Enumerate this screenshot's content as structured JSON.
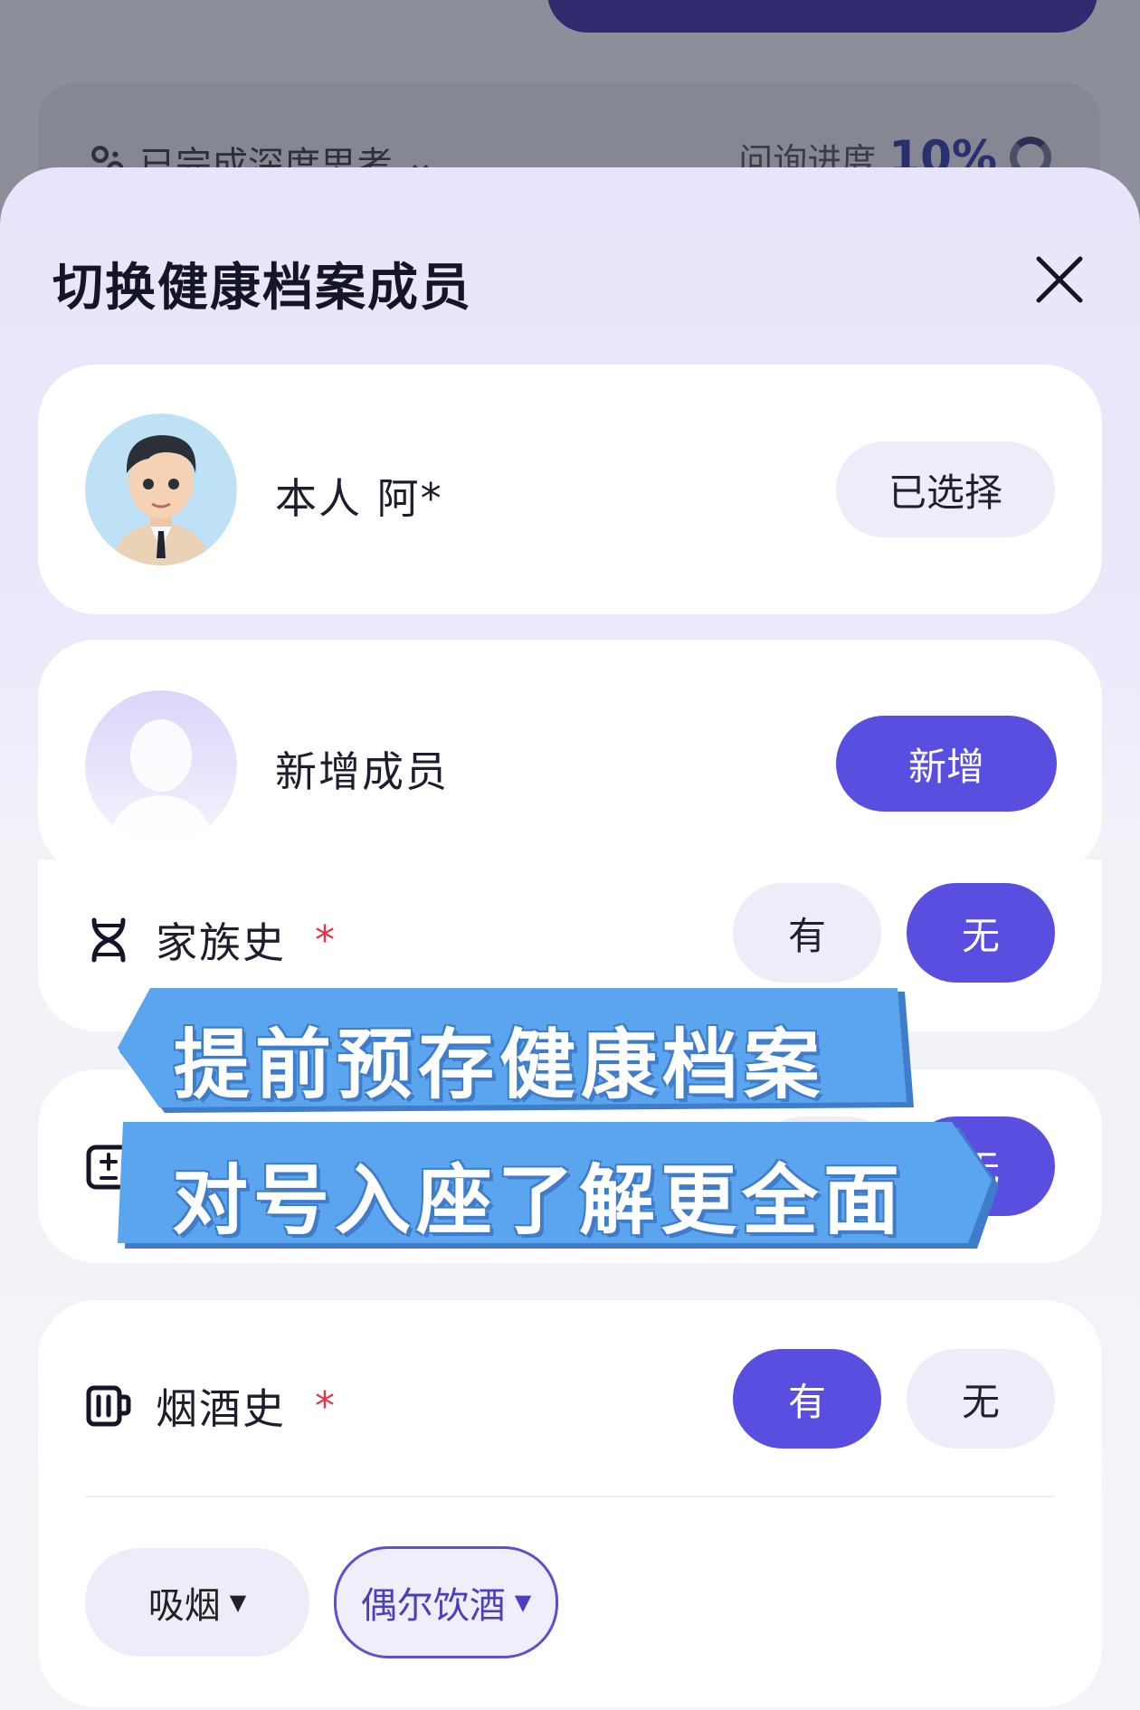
{
  "background": {
    "status_text": "已完成深度思考",
    "progress_label": "问询进度",
    "progress_value": "10%"
  },
  "sheet": {
    "title": "切换健康档案成员"
  },
  "members": [
    {
      "name": "本人 阿*",
      "action": "已选择",
      "selected": true
    },
    {
      "name": "新增成员",
      "action": "新增",
      "selected": false
    }
  ],
  "rows": {
    "family_history": {
      "label": "家族史",
      "required": "*",
      "yes": "有",
      "no": "无",
      "value": "无"
    },
    "row2": {
      "selected": "无"
    },
    "smoke_drink": {
      "label": "烟酒史",
      "required": "*",
      "yes": "有",
      "no": "无",
      "value": "有",
      "chips": [
        {
          "label": "吸烟",
          "active": false
        },
        {
          "label": "偶尔饮酒",
          "active": true
        }
      ]
    }
  },
  "overlay": {
    "line1": "提前预存健康档案",
    "line2": "对号入座了解更全面"
  },
  "colors": {
    "primary": "#5a4ee0",
    "required": "#e0344d",
    "banner_blue": "#5ba5ee"
  },
  "icons": [
    "dna-icon",
    "plus-minus-icon",
    "cup-icon",
    "close-icon",
    "chevron-down-icon",
    "caret-down-icon"
  ]
}
